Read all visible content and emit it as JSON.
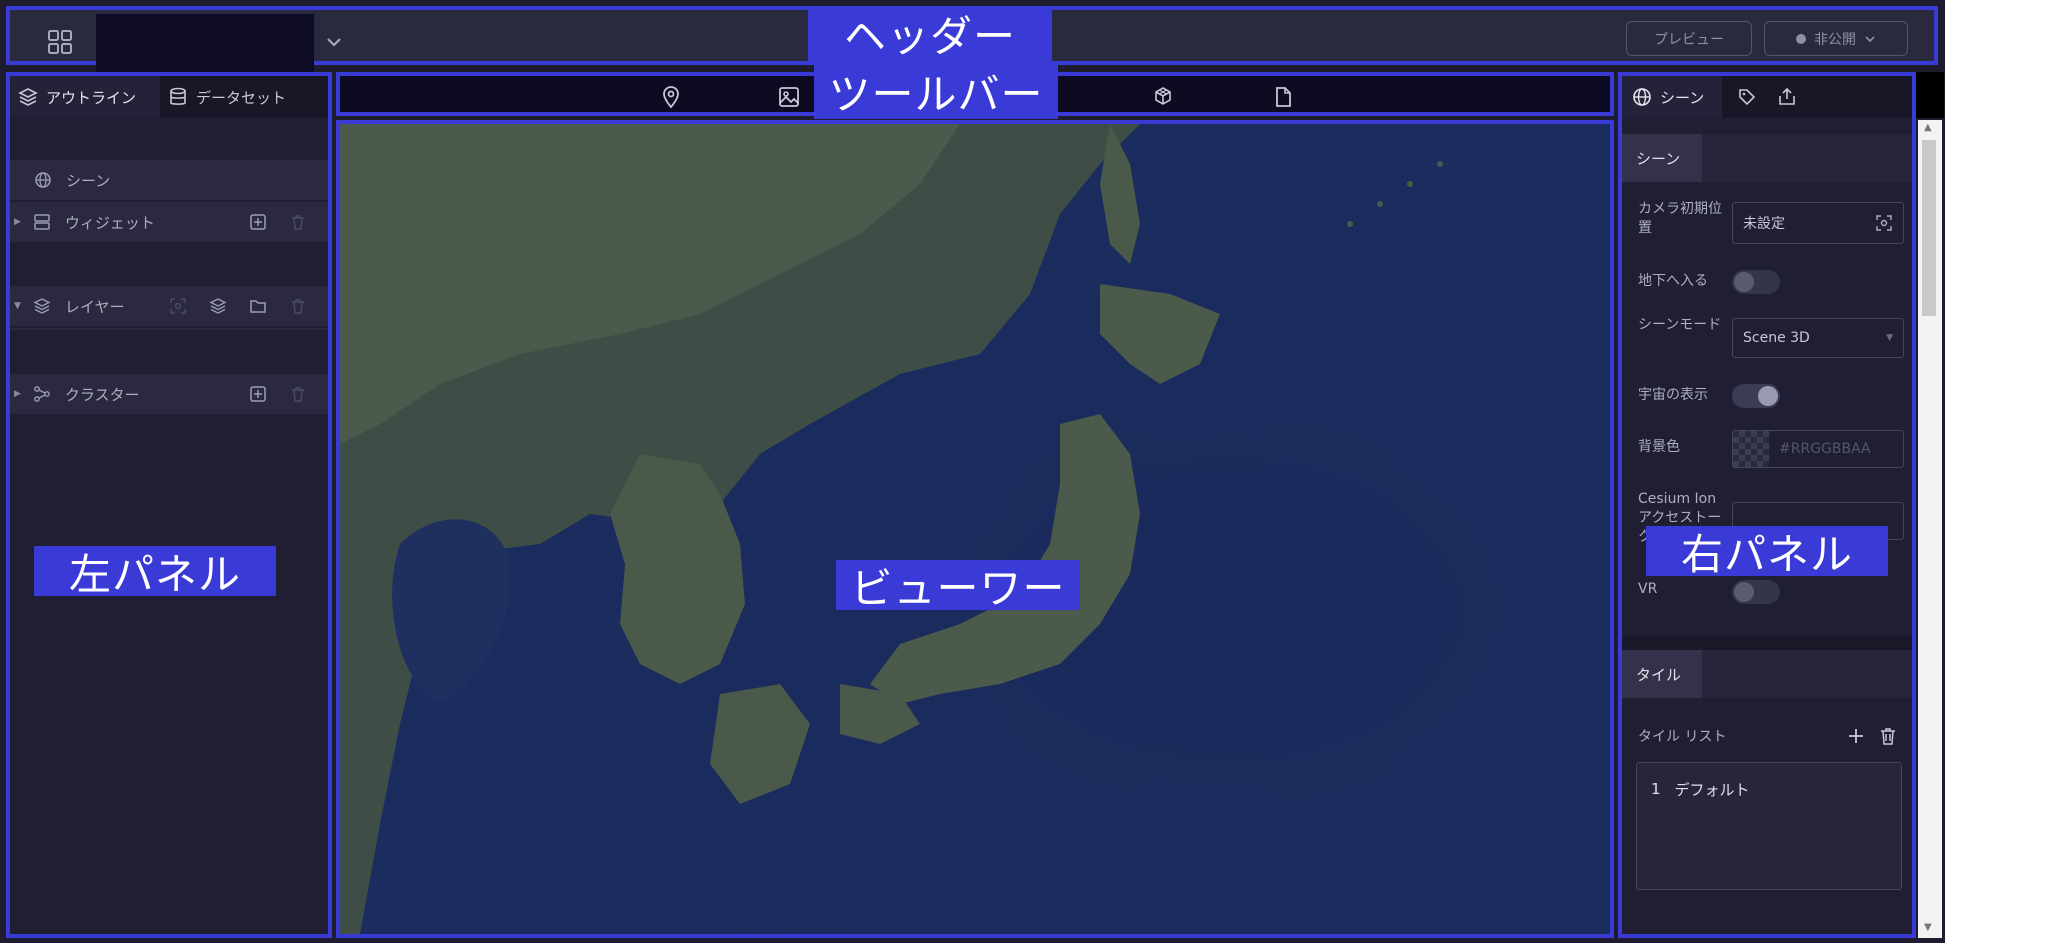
{
  "header": {
    "callout": "ヘッダー",
    "preview_label": "プレビュー",
    "publish_label": "非公開"
  },
  "left_panel": {
    "callout": "左パネル",
    "tabs": [
      {
        "label": "アウトライン",
        "icon": "layers-icon"
      },
      {
        "label": "データセット",
        "icon": "database-icon"
      }
    ],
    "rows": {
      "scene": "シーン",
      "widget": "ウィジェット",
      "layer": "レイヤー",
      "cluster": "クラスター"
    }
  },
  "toolbar": {
    "callout": "ツールバー",
    "icons": [
      "map-pin-icon",
      "image-icon",
      "cube-icon",
      "file-icon"
    ]
  },
  "viewer": {
    "callout": "ビューワー"
  },
  "right_panel": {
    "callout": "右パネル",
    "tabs": [
      {
        "label": "シーン",
        "icon": "globe-icon"
      },
      {
        "label": "",
        "icon": "tag-icon"
      },
      {
        "label": "",
        "icon": "publish-icon"
      }
    ],
    "scene_section": {
      "title": "シーン",
      "camera_label": "カメラ初期位置",
      "camera_value": "未設定",
      "underground_label": "地下へ入る",
      "underground_on": false,
      "scene_mode_label": "シーンモード",
      "scene_mode_value": "Scene 3D",
      "sky_label": "宇宙の表示",
      "sky_on": true,
      "bg_color_label": "背景色",
      "bg_color_placeholder": "#RRGGBBAA",
      "ion_label": "Cesium Ion アクセストークン",
      "ion_value": "",
      "vr_label": "VR",
      "vr_on": false
    },
    "tile_section": {
      "title": "タイル",
      "list_label": "タイル リスト",
      "items": [
        {
          "index": "1",
          "name": "デフォルト"
        }
      ]
    }
  },
  "colors": {
    "accent": "#3a3ad6",
    "panel_bg": "#1f1e32",
    "ocean": "#1c2c5e"
  }
}
